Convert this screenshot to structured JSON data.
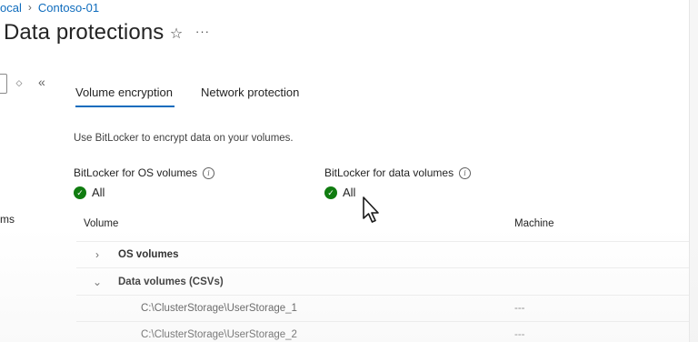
{
  "breadcrumb": {
    "items": [
      "ocal",
      "Contoso-01"
    ],
    "separator": "›"
  },
  "header": {
    "title": "Data protections",
    "favorite_icon": "star-icon",
    "more_label": "···"
  },
  "sidebar": {
    "fragment_text": "ms"
  },
  "tabs": [
    {
      "label": "Volume encryption",
      "active": true
    },
    {
      "label": "Network protection",
      "active": false
    }
  ],
  "content": {
    "description": "Use BitLocker to encrypt data on your volumes.",
    "os_volumes": {
      "label": "BitLocker for OS volumes",
      "status": "All"
    },
    "data_volumes": {
      "label": "BitLocker for data volumes",
      "status": "All"
    }
  },
  "table": {
    "columns": [
      "Volume",
      "Machine"
    ],
    "groups": [
      {
        "label": "OS volumes",
        "expanded": false
      },
      {
        "label": "Data volumes (CSVs)",
        "expanded": true
      }
    ],
    "rows": [
      {
        "volume": "C:\\ClusterStorage\\UserStorage_1",
        "machine": "---"
      },
      {
        "volume": "C:\\ClusterStorage\\UserStorage_2",
        "machine": "---"
      }
    ]
  },
  "colors": {
    "accent": "#0f6cbd",
    "success": "#107c10"
  }
}
